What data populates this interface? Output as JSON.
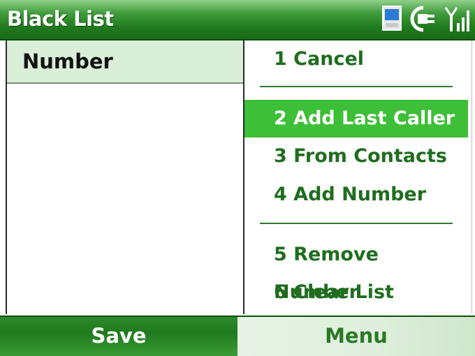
{
  "window": {
    "title": "Black List"
  },
  "status_icons": [
    "device-icon",
    "power-plug-icon",
    "signal-strength-icon"
  ],
  "list": {
    "column_header": "Number"
  },
  "menu": {
    "items": [
      {
        "label": "1 Cancel"
      },
      {
        "label": "2 Add Last Caller",
        "selected": true
      },
      {
        "label": "3 From Contacts"
      },
      {
        "label": "4 Add Number"
      },
      {
        "label": "5 Remove Number"
      },
      {
        "label": "6 Clear List"
      }
    ]
  },
  "softkeys": {
    "left": "Save",
    "right": "Menu"
  },
  "colors": {
    "accent": "#1f7a1d",
    "selected": "#3dbf37",
    "menu_text": "#1f6d1f",
    "header_bg": "#d9efd7"
  }
}
